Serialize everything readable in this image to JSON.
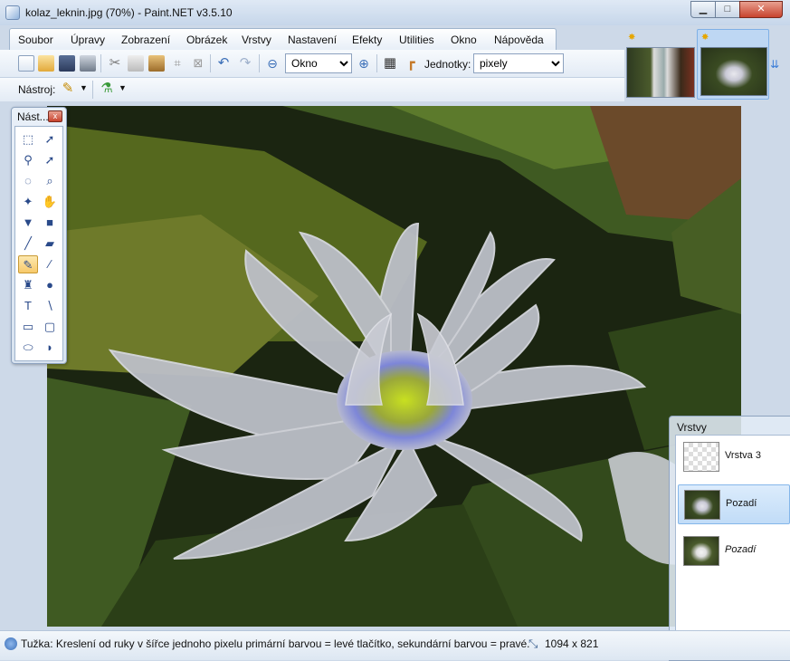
{
  "window": {
    "title": "kolaz_leknin.jpg (70%) - Paint.NET v3.5.10",
    "min_symbol": "▁",
    "max_symbol": "□",
    "close_symbol": "✕"
  },
  "menu": [
    "Soubor",
    "Úpravy",
    "Zobrazení",
    "Obrázek",
    "Vrstvy",
    "Nastavení",
    "Efekty",
    "Utilities",
    "Okno",
    "Nápověda"
  ],
  "toolbar": {
    "zoom_value": "Okno",
    "units_label": "Jednotky:",
    "units_value": "pixely",
    "tool_label": "Nástroj:"
  },
  "tools_window": {
    "title": "Nást...",
    "close_symbol": "x",
    "tools": [
      {
        "icon": "rectangle-select-icon",
        "glyph": "⬚"
      },
      {
        "icon": "move-selection-icon",
        "glyph": "➚"
      },
      {
        "icon": "lasso-select-icon",
        "glyph": "⚲"
      },
      {
        "icon": "move-selected-icon",
        "glyph": "➚"
      },
      {
        "icon": "ellipse-select-icon",
        "glyph": "◌"
      },
      {
        "icon": "zoom-icon",
        "glyph": "⌕"
      },
      {
        "icon": "magic-wand-icon",
        "glyph": "✦"
      },
      {
        "icon": "pan-icon",
        "glyph": "✋"
      },
      {
        "icon": "paint-bucket-icon",
        "glyph": "▼"
      },
      {
        "icon": "gradient-icon",
        "glyph": "■"
      },
      {
        "icon": "paintbrush-icon",
        "glyph": "╱"
      },
      {
        "icon": "eraser-icon",
        "glyph": "▰"
      },
      {
        "icon": "pencil-icon",
        "glyph": "✎"
      },
      {
        "icon": "color-picker-icon",
        "glyph": "⁄"
      },
      {
        "icon": "clone-stamp-icon",
        "glyph": "♜"
      },
      {
        "icon": "recolor-icon",
        "glyph": "●"
      },
      {
        "icon": "text-icon",
        "glyph": "T"
      },
      {
        "icon": "line-curve-icon",
        "glyph": "∖"
      },
      {
        "icon": "rectangle-icon",
        "glyph": "▭"
      },
      {
        "icon": "rounded-rectangle-icon",
        "glyph": "▢"
      },
      {
        "icon": "ellipse-icon",
        "glyph": "⬭"
      },
      {
        "icon": "freeform-shape-icon",
        "glyph": "◗"
      }
    ],
    "selected_index": 12
  },
  "layers_window": {
    "title": "Vrstvy",
    "layers": [
      {
        "name": "Vrstva 3",
        "italic": false,
        "selected": false
      },
      {
        "name": "Pozadí",
        "italic": false,
        "selected": true
      },
      {
        "name": "Pozadí",
        "italic": true,
        "selected": false
      }
    ]
  },
  "status": {
    "text": "Tužka: Kreslení od ruky v šířce jednoho pixelu primární barvou = levé tlačítko, sekundární barvou = pravé.",
    "size": "1094 x 821"
  },
  "colors": {
    "accent": "#3b7dd8",
    "selection": "#c1dcf7",
    "close_red": "#c8432e"
  }
}
